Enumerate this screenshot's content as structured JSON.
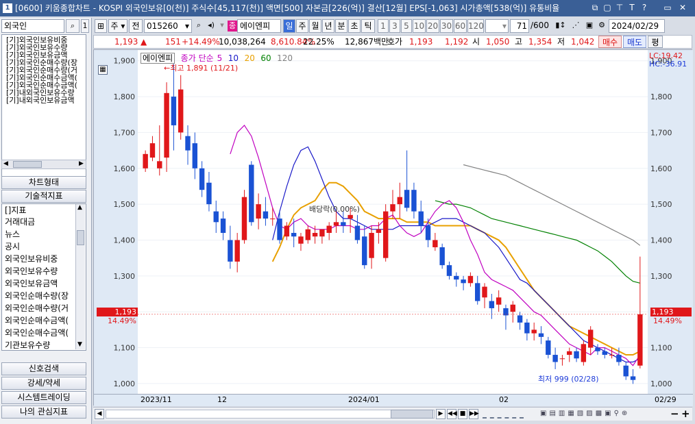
{
  "titlebar": {
    "num": "1",
    "text": "[0600] 키움종합차트 - KOSPI 외국인보유[0(천)] 주식수[45,117(천)] 액면[500] 자본금[226(억)] 결산[12월] EPS[-1,063] 시가총액[538(억)] 유통비율",
    "btns": [
      "⧉",
      "▢",
      "⊤",
      "T",
      "?",
      "▭",
      "✕"
    ]
  },
  "left": {
    "investor_combo": "외국인",
    "search_icon": "search-icon",
    "combo_suffix": "1",
    "investor_list": [
      "[기]외국인보유비중",
      "[기]외국인보유수량",
      "[기]외국인보유금액",
      "[기]외국인순매수량(장",
      "[기]외국인순매수량(거",
      "[기]외국인순매수금액(",
      "[기]외국인순매수금액(",
      "[기]내외국인보유수량",
      "[기]내외국인보유금액"
    ],
    "chart_type_btn": "차트형태",
    "tech_btn": "기술적지표",
    "indicator_list": [
      "[]지표",
      "거래대금",
      "뉴스",
      "공시",
      "외국인보유비중",
      "외국인보유수량",
      "외국인보유금액",
      "외국인순매수량(장",
      "외국인순매수량(거",
      "외국인순매수금액(",
      "외국인순매수금액(",
      "기관보유수량"
    ],
    "bottom_btns": [
      "신호검색",
      "강세/약세",
      "시스템트레이딩",
      "나의 관심지표"
    ]
  },
  "toolbar": {
    "period_label": "주",
    "all_label": "전",
    "code_value": "015260",
    "stock_badge": "종",
    "stock_name": "에이엔피",
    "tabs": [
      "일",
      "주",
      "월",
      "년",
      "분",
      "초",
      "틱"
    ],
    "active_tab": "일",
    "numbers": [
      "1",
      "3",
      "5",
      "10",
      "20",
      "30",
      "60",
      "120"
    ],
    "count_value": "71",
    "count_total": "/600",
    "date_value": "2024/02/29"
  },
  "price_row": {
    "price": "1,193",
    "price_arrow": "▲",
    "change": "151",
    "change_pct": "+14.49%",
    "volume": "10,038,264",
    "vol_pct": "8,610.84%",
    "turnover": "22.25%",
    "amount": "12,867백만",
    "ask_label": "호가",
    "ask": "1,193",
    "bid": "1,192",
    "open_label": "시",
    "open": "1,050",
    "high_label": "고",
    "high": "1,354",
    "low_label": "저",
    "low": "1,042",
    "buy_btn": "매수",
    "sell_btn": "매도",
    "flat_btn": "평"
  },
  "chart_data": {
    "type": "candlestick",
    "stock": "에이엔피",
    "legend": {
      "ma_label": "종가 단순",
      "periods": [
        "5",
        "10",
        "20",
        "60",
        "120"
      ],
      "colors": [
        "#c000c0",
        "#1818c8",
        "#e8a000",
        "#008000",
        "#808080"
      ]
    },
    "y_ticks": [
      "1,900",
      "1,800",
      "1,700",
      "1,600",
      "1,500",
      "1,400",
      "1,300",
      "1,200",
      "1,100",
      "1,000"
    ],
    "y_range": [
      975,
      1930
    ],
    "x_labels": [
      "2023/11",
      "12",
      "2024/01",
      "02"
    ],
    "x_right_label": "02/29",
    "lc_label": "LC:19.42",
    "hc_label": "HC:-36.91",
    "current_price_tag": "1,193",
    "current_pct_tag": "14.49%",
    "high_annotation": "←최고 1,891 (11/21)",
    "low_annotation": "최저 999 (02/28)",
    "dividend_annotation": "배당락(0.00%)",
    "candles": [
      {
        "o": 1600,
        "h": 1650,
        "l": 1590,
        "c": 1640
      },
      {
        "o": 1630,
        "h": 1690,
        "l": 1620,
        "c": 1670
      },
      {
        "o": 1600,
        "h": 1720,
        "l": 1580,
        "c": 1620
      },
      {
        "o": 1630,
        "h": 1840,
        "l": 1590,
        "c": 1810
      },
      {
        "o": 1800,
        "h": 1891,
        "l": 1650,
        "c": 1720
      },
      {
        "o": 1700,
        "h": 1860,
        "l": 1680,
        "c": 1820
      },
      {
        "o": 1690,
        "h": 1720,
        "l": 1610,
        "c": 1650
      },
      {
        "o": 1670,
        "h": 1700,
        "l": 1570,
        "c": 1600
      },
      {
        "o": 1600,
        "h": 1620,
        "l": 1520,
        "c": 1540
      },
      {
        "o": 1560,
        "h": 1590,
        "l": 1480,
        "c": 1500
      },
      {
        "o": 1480,
        "h": 1510,
        "l": 1420,
        "c": 1450
      },
      {
        "o": 1460,
        "h": 1480,
        "l": 1400,
        "c": 1420
      },
      {
        "o": 1400,
        "h": 1440,
        "l": 1320,
        "c": 1340
      },
      {
        "o": 1340,
        "h": 1420,
        "l": 1310,
        "c": 1400
      },
      {
        "o": 1400,
        "h": 1540,
        "l": 1390,
        "c": 1520
      },
      {
        "o": 1610,
        "h": 1620,
        "l": 1440,
        "c": 1450
      },
      {
        "o": 1460,
        "h": 1530,
        "l": 1430,
        "c": 1500
      },
      {
        "o": 1480,
        "h": 1520,
        "l": 1440,
        "c": 1460
      },
      {
        "o": 1460,
        "h": 1490,
        "l": 1440,
        "c": 1460
      },
      {
        "o": 1460,
        "h": 1480,
        "l": 1390,
        "c": 1400
      },
      {
        "o": 1410,
        "h": 1450,
        "l": 1400,
        "c": 1440
      },
      {
        "o": 1420,
        "h": 1460,
        "l": 1380,
        "c": 1410
      },
      {
        "o": 1390,
        "h": 1420,
        "l": 1370,
        "c": 1410
      },
      {
        "o": 1400,
        "h": 1440,
        "l": 1390,
        "c": 1430
      },
      {
        "o": 1410,
        "h": 1440,
        "l": 1390,
        "c": 1420
      },
      {
        "o": 1410,
        "h": 1430,
        "l": 1390,
        "c": 1430
      },
      {
        "o": 1420,
        "h": 1450,
        "l": 1400,
        "c": 1440
      },
      {
        "o": 1440,
        "h": 1480,
        "l": 1420,
        "c": 1450
      },
      {
        "o": 1450,
        "h": 1480,
        "l": 1420,
        "c": 1440
      },
      {
        "o": 1460,
        "h": 1490,
        "l": 1420,
        "c": 1470
      },
      {
        "o": 1440,
        "h": 1470,
        "l": 1390,
        "c": 1400
      },
      {
        "o": 1410,
        "h": 1440,
        "l": 1320,
        "c": 1330
      },
      {
        "o": 1350,
        "h": 1440,
        "l": 1320,
        "c": 1420
      },
      {
        "o": 1420,
        "h": 1450,
        "l": 1390,
        "c": 1430
      },
      {
        "o": 1350,
        "h": 1500,
        "l": 1340,
        "c": 1480
      },
      {
        "o": 1480,
        "h": 1540,
        "l": 1460,
        "c": 1500
      },
      {
        "o": 1500,
        "h": 1560,
        "l": 1460,
        "c": 1520
      },
      {
        "o": 1540,
        "h": 1650,
        "l": 1480,
        "c": 1490
      },
      {
        "o": 1540,
        "h": 1560,
        "l": 1460,
        "c": 1480
      },
      {
        "o": 1480,
        "h": 1510,
        "l": 1420,
        "c": 1440
      },
      {
        "o": 1440,
        "h": 1460,
        "l": 1380,
        "c": 1400
      },
      {
        "o": 1380,
        "h": 1420,
        "l": 1370,
        "c": 1400
      },
      {
        "o": 1380,
        "h": 1390,
        "l": 1320,
        "c": 1330
      },
      {
        "o": 1330,
        "h": 1340,
        "l": 1290,
        "c": 1300
      },
      {
        "o": 1300,
        "h": 1310,
        "l": 1270,
        "c": 1290
      },
      {
        "o": 1290,
        "h": 1300,
        "l": 1260,
        "c": 1280
      },
      {
        "o": 1280,
        "h": 1310,
        "l": 1270,
        "c": 1300
      },
      {
        "o": 1280,
        "h": 1300,
        "l": 1220,
        "c": 1230
      },
      {
        "o": 1240,
        "h": 1280,
        "l": 1210,
        "c": 1270
      },
      {
        "o": 1230,
        "h": 1250,
        "l": 1180,
        "c": 1210
      },
      {
        "o": 1220,
        "h": 1260,
        "l": 1200,
        "c": 1240
      },
      {
        "o": 1210,
        "h": 1220,
        "l": 1150,
        "c": 1190
      },
      {
        "o": 1200,
        "h": 1230,
        "l": 1170,
        "c": 1220
      },
      {
        "o": 1190,
        "h": 1200,
        "l": 1150,
        "c": 1170
      },
      {
        "o": 1170,
        "h": 1180,
        "l": 1120,
        "c": 1140
      },
      {
        "o": 1140,
        "h": 1170,
        "l": 1120,
        "c": 1150
      },
      {
        "o": 1140,
        "h": 1160,
        "l": 1110,
        "c": 1130
      },
      {
        "o": 1120,
        "h": 1130,
        "l": 1070,
        "c": 1080
      },
      {
        "o": 1080,
        "h": 1100,
        "l": 1040,
        "c": 1060
      },
      {
        "o": 1070,
        "h": 1080,
        "l": 1050,
        "c": 1070
      },
      {
        "o": 1080,
        "h": 1100,
        "l": 1060,
        "c": 1090
      },
      {
        "o": 1090,
        "h": 1100,
        "l": 1060,
        "c": 1070
      },
      {
        "o": 1060,
        "h": 1120,
        "l": 1050,
        "c": 1110
      },
      {
        "o": 1100,
        "h": 1160,
        "l": 1080,
        "c": 1150
      },
      {
        "o": 1100,
        "h": 1110,
        "l": 1080,
        "c": 1090
      },
      {
        "o": 1090,
        "h": 1100,
        "l": 1070,
        "c": 1080
      },
      {
        "o": 1080,
        "h": 1100,
        "l": 1070,
        "c": 1080
      },
      {
        "o": 1080,
        "h": 1100,
        "l": 1050,
        "c": 1060
      },
      {
        "o": 1050,
        "h": 1060,
        "l": 1010,
        "c": 1020
      },
      {
        "o": 1020,
        "h": 1040,
        "l": 999,
        "c": 1010
      },
      {
        "o": 1050,
        "h": 1354,
        "l": 1042,
        "c": 1193
      }
    ],
    "ma": {
      "ma5": [
        1640,
        1700,
        1720,
        1690,
        1630,
        1560,
        1490,
        1440,
        1430,
        1450,
        1460,
        1440,
        1430,
        1430,
        1430,
        1440,
        1440,
        1440,
        1430,
        1430,
        1440,
        1440,
        1460,
        1470,
        1440,
        1420,
        1410,
        1420,
        1450,
        1480,
        1500,
        1510,
        1490,
        1450,
        1400,
        1360,
        1310,
        1290,
        1280,
        1270,
        1260,
        1240,
        1220,
        1200,
        1190,
        1170,
        1150,
        1130,
        1110,
        1100,
        1090,
        1080,
        1100,
        1100,
        1090,
        1080,
        1070,
        1050,
        1080
      ],
      "ma10": [
        1400,
        1480,
        1550,
        1610,
        1650,
        1660,
        1620,
        1570,
        1520,
        1480,
        1460,
        1460,
        1450,
        1440,
        1430,
        1430,
        1430,
        1430,
        1440,
        1440,
        1440,
        1440,
        1440,
        1450,
        1460,
        1460,
        1460,
        1450,
        1440,
        1430,
        1420,
        1400,
        1380,
        1350,
        1320,
        1290,
        1280,
        1260,
        1240,
        1220,
        1200,
        1180,
        1160,
        1140,
        1120,
        1110,
        1100,
        1090,
        1080,
        1070,
        1060,
        1060,
        1070
      ],
      "ma20": [
        1340,
        1380,
        1430,
        1470,
        1490,
        1500,
        1510,
        1540,
        1560,
        1560,
        1550,
        1530,
        1510,
        1480,
        1470,
        1460,
        1460,
        1460,
        1460,
        1450,
        1450,
        1450,
        1450,
        1440,
        1440,
        1440,
        1440,
        1440,
        1440,
        1430,
        1420,
        1410,
        1400,
        1380,
        1350,
        1320,
        1290,
        1260,
        1240,
        1220,
        1200,
        1180,
        1160,
        1150,
        1140,
        1130,
        1120,
        1110,
        1100,
        1090,
        1080,
        1080,
        1090
      ],
      "ma60": [
        1510,
        1505,
        1500,
        1500,
        1495,
        1490,
        1480,
        1470,
        1460,
        1455,
        1450,
        1445,
        1440,
        1435,
        1430,
        1425,
        1420,
        1415,
        1410,
        1405,
        1400,
        1390,
        1380,
        1370,
        1355,
        1340,
        1320,
        1300,
        1285,
        1280
      ],
      "ma120": [
        1610,
        1605,
        1600,
        1595,
        1590,
        1585,
        1580,
        1570,
        1560,
        1550,
        1540,
        1530,
        1520,
        1510,
        1500,
        1490,
        1480,
        1470,
        1460,
        1450,
        1440,
        1430,
        1420,
        1410,
        1400,
        1385
      ]
    }
  },
  "bottom_bar": {
    "nav": [
      "◀",
      "▶",
      "◀◀",
      "■",
      "▶▶"
    ],
    "right": [
      "−",
      "+"
    ]
  }
}
